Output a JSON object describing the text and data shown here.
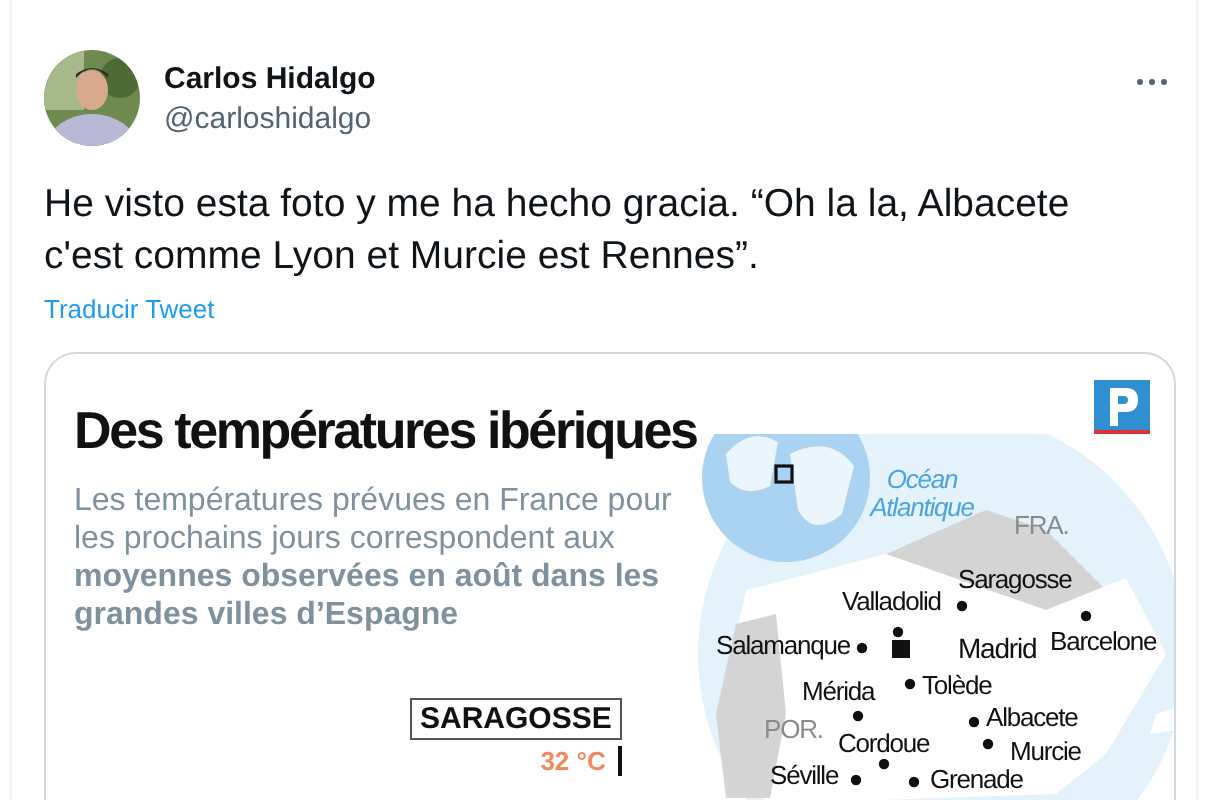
{
  "author": {
    "name": "Carlos Hidalgo",
    "handle": "@carloshidalgo"
  },
  "tweet": {
    "text": "He visto esta foto y me ha hecho gracia. “Oh la la, Albacete c'est comme Lyon et Murcie est Rennes”.",
    "translate_link": "Traducir Tweet"
  },
  "image": {
    "title": "Des températures ibériques",
    "subtitle": "Les températures prévues en France pour les prochains jours correspondent aux **moyennes observées en août dans les grandes villes d’Espagne**",
    "callout": {
      "city": "SARAGOSSE",
      "temperature": "32 °C"
    },
    "map_labels": [
      {
        "text": "Océan Atlantique",
        "kind": "sea"
      },
      {
        "text": "FRA.",
        "kind": "country"
      },
      {
        "text": "Saragosse",
        "kind": "city"
      },
      {
        "text": "Valladolid",
        "kind": "city"
      },
      {
        "text": "Salamanque",
        "kind": "city"
      },
      {
        "text": "Madrid",
        "kind": "capital"
      },
      {
        "text": "Barcelone",
        "kind": "city"
      },
      {
        "text": "Mérida",
        "kind": "city"
      },
      {
        "text": "Tolède",
        "kind": "city"
      },
      {
        "text": "POR.",
        "kind": "country"
      },
      {
        "text": "Albacete",
        "kind": "city"
      },
      {
        "text": "Cordoue",
        "kind": "city"
      },
      {
        "text": "Murcie",
        "kind": "city"
      },
      {
        "text": "Séville",
        "kind": "city"
      },
      {
        "text": "Grenade",
        "kind": "city"
      }
    ]
  }
}
